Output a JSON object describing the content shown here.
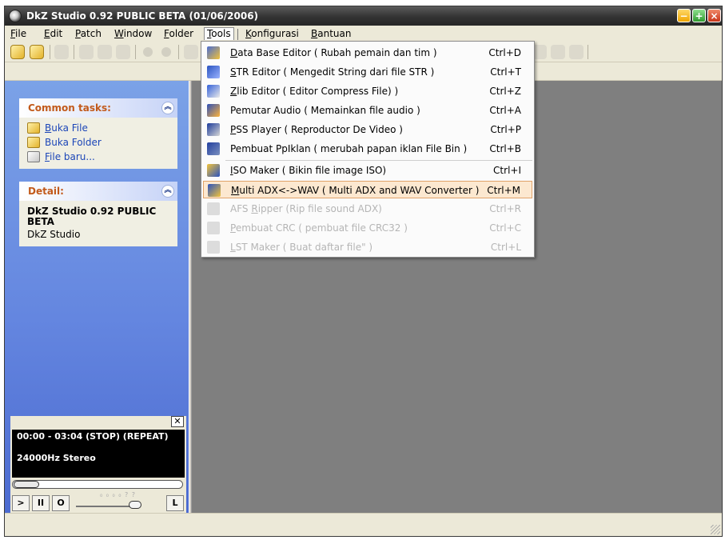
{
  "window": {
    "title": "DkZ Studio 0.92 PUBLIC BETA (01/06/2006)"
  },
  "menu": {
    "items": [
      {
        "key": "file",
        "pre": "",
        "ul": "F",
        "post": "ile"
      },
      {
        "key": "edit",
        "pre": "",
        "ul": "E",
        "post": "dit"
      },
      {
        "key": "patch",
        "pre": "",
        "ul": "P",
        "post": "atch"
      },
      {
        "key": "window",
        "pre": "",
        "ul": "W",
        "post": "indow"
      },
      {
        "key": "folder",
        "pre": "",
        "ul": "F",
        "post": "older"
      },
      {
        "key": "tools",
        "pre": "",
        "ul": "T",
        "post": "ools"
      },
      {
        "key": "konfigurasi",
        "pre": "",
        "ul": "K",
        "post": "onfigurasi"
      },
      {
        "key": "bantuan",
        "pre": "",
        "ul": "B",
        "post": "antuan"
      }
    ],
    "active": "tools"
  },
  "sidebar": {
    "common_tasks": {
      "title": "Common tasks:",
      "toggle_glyph": "︽",
      "items": [
        {
          "ul": "B",
          "rest": "uka File",
          "icon": "folder-open-icon"
        },
        {
          "ul": "",
          "rest": "Buka Folder",
          "icon": "folder-icon"
        },
        {
          "ul": "F",
          "rest": "ile baru...",
          "icon": "new-file-icon"
        }
      ]
    },
    "detail": {
      "title": "Detail:",
      "toggle_glyph": "︽",
      "name": "DkZ Studio 0.92 PUBLIC BETA",
      "sub": "DkZ Studio"
    }
  },
  "player": {
    "close_glyph": "✕",
    "time_text": "00:00 - 03:04  (STOP) (REPEAT)",
    "freq_text": "24000Hz  Stereo",
    "buttons": {
      "play": ">",
      "pause": "II",
      "stop": "O",
      "loop": "L"
    },
    "volume_dots": "₀ ₀ ₀ ₀ ? ?"
  },
  "tools_menu": {
    "items": [
      {
        "ul": "D",
        "rest": "ata Base Editor ( Rubah pemain dan tim )",
        "shortcut": "Ctrl+D",
        "icon": "database-editor-icon",
        "state": "normal"
      },
      {
        "ul": "S",
        "rest": "TR Editor ( Mengedit String dari file STR )",
        "shortcut": "Ctrl+T",
        "icon": "str-editor-icon",
        "state": "normal"
      },
      {
        "ul": "Z",
        "rest": "lib Editor ( Editor Compress File) )",
        "shortcut": "Ctrl+Z",
        "icon": "zlib-editor-icon",
        "state": "normal"
      },
      {
        "ul": "",
        "rest": "Pemutar Audio ( Memainkan file audio )",
        "shortcut": "Ctrl+A",
        "icon": "audio-player-icon",
        "state": "normal"
      },
      {
        "ul": "P",
        "rest": "SS Player ( Reproductor De Video )",
        "shortcut": "Ctrl+P",
        "icon": "pss-player-icon",
        "state": "normal"
      },
      {
        "ul": "",
        "rest": "Pembuat PpIklan ( merubah papan iklan File Bin )",
        "shortcut": "Ctrl+B",
        "icon": "billboard-maker-icon",
        "state": "normal"
      },
      {
        "ul": "I",
        "rest": "SO Maker ( Bikin file image ISO)",
        "shortcut": "Ctrl+I",
        "icon": "iso-maker-icon",
        "state": "normal"
      },
      {
        "ul": "M",
        "rest": "ulti ADX<->WAV ( Multi  ADX and WAV Converter )",
        "shortcut": "Ctrl+M",
        "icon": "adx-wav-converter-icon",
        "state": "highlight"
      },
      {
        "pre": "AFS ",
        "ul": "R",
        "rest": "ipper (Rip file sound ADX)",
        "shortcut": "Ctrl+R",
        "icon": "afs-ripper-icon",
        "state": "disabled"
      },
      {
        "ul": "P",
        "rest": "embuat CRC ( pembuat file CRC32  )",
        "shortcut": "Ctrl+C",
        "icon": "crc-maker-icon",
        "state": "disabled"
      },
      {
        "ul": "L",
        "rest": "ST Maker ( Buat daftar file\" )",
        "shortcut": "Ctrl+L",
        "icon": "lst-maker-icon",
        "state": "disabled"
      }
    ]
  }
}
